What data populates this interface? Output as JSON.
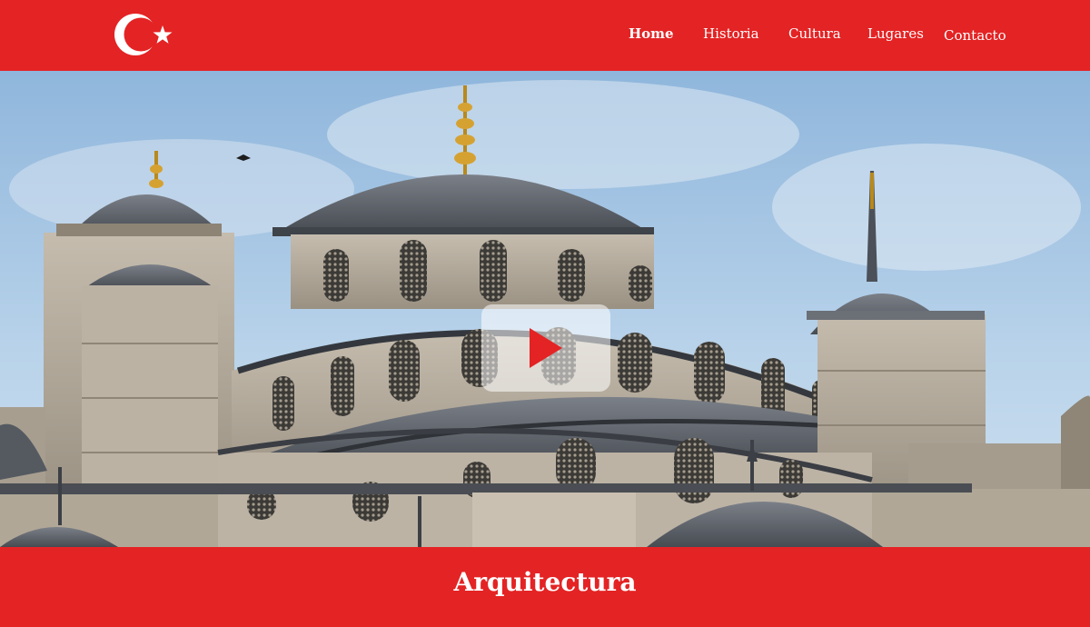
{
  "header": {
    "logo_icon": "turkish-crescent-star-icon",
    "nav": [
      {
        "label": "Home",
        "active": true
      },
      {
        "label": "Historia",
        "active": false
      },
      {
        "label": "Cultura",
        "active": false
      },
      {
        "label": "Lugares",
        "active": false
      },
      {
        "label": "Contacto",
        "active": false
      }
    ]
  },
  "hero": {
    "image": "blue-mosque-domes-photo",
    "play_icon": "play-icon"
  },
  "section": {
    "title": "Arquitectura"
  },
  "colors": {
    "brand_red": "#e42324",
    "text_light": "#ffffff",
    "sky_blue": "#a9c6e4",
    "stone": "#b5ab9c",
    "dome_lead": "#5c6168"
  }
}
